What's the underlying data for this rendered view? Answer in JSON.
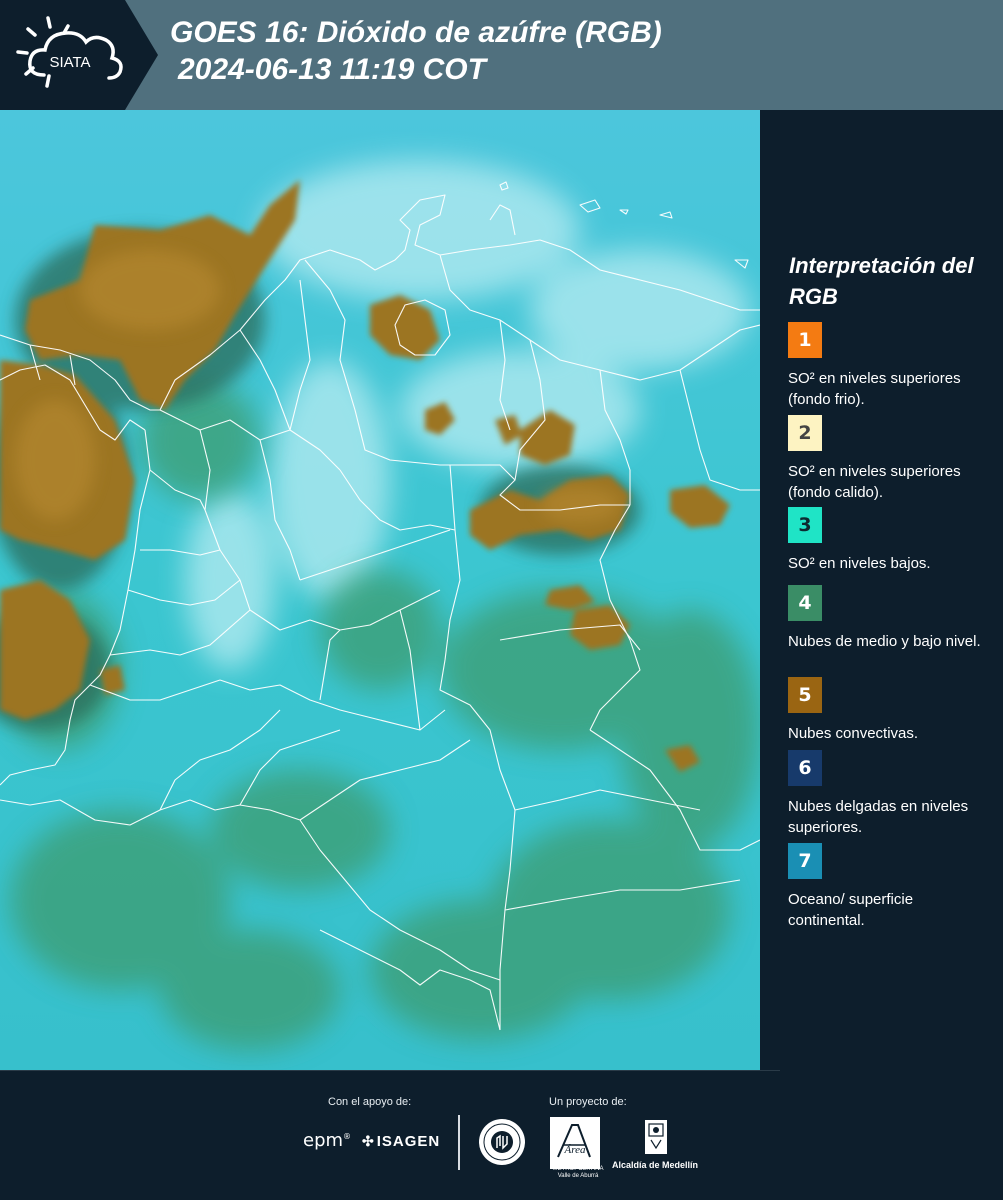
{
  "header": {
    "logo_text": "SIATA",
    "title_line1": "GOES 16: Dióxido de azúfre (RGB)",
    "title_line2": "2024-06-13 11:19 COT"
  },
  "legend": {
    "title": "Interpretación del RGB",
    "items": [
      {
        "number": "1",
        "color": "#f47b12",
        "text_color": "#ffffff",
        "label": "SO² en niveles superiores (fondo frio)."
      },
      {
        "number": "2",
        "color": "#fdf3c2",
        "text_color": "#333333",
        "label": "SO² en niveles superiores (fondo calido)."
      },
      {
        "number": "3",
        "color": "#1fe4c6",
        "text_color": "#0d2a30",
        "label": "SO² en niveles bajos."
      },
      {
        "number": "4",
        "color": "#3a8d66",
        "text_color": "#ffffff",
        "label": "Nubes de medio y bajo nivel."
      },
      {
        "number": "5",
        "color": "#9a6512",
        "text_color": "#ffffff",
        "label": "Nubes convectivas."
      },
      {
        "number": "6",
        "color": "#173a6b",
        "text_color": "#ffffff",
        "label": "Nubes delgadas en niveles superiores."
      },
      {
        "number": "7",
        "color": "#1a8fb4",
        "text_color": "#ffffff",
        "label": "Oceano/ superficie continental."
      }
    ]
  },
  "footer": {
    "support_label": "Con el apoyo de:",
    "project_label": "Un proyecto de:",
    "epm": "epm",
    "isagen": "ISAGEN",
    "area_logo_text": "Área",
    "area_caption": "METROPOLITANA Valle de Aburrá",
    "alcaldia": "Alcaldía de Medellín"
  },
  "colors": {
    "header_bg": "#50707e",
    "header_dark": "#0d1e2c",
    "map_base": "#35c4d4",
    "cloud_brown": "#9c7420",
    "cloud_green": "#3e9a6a"
  }
}
